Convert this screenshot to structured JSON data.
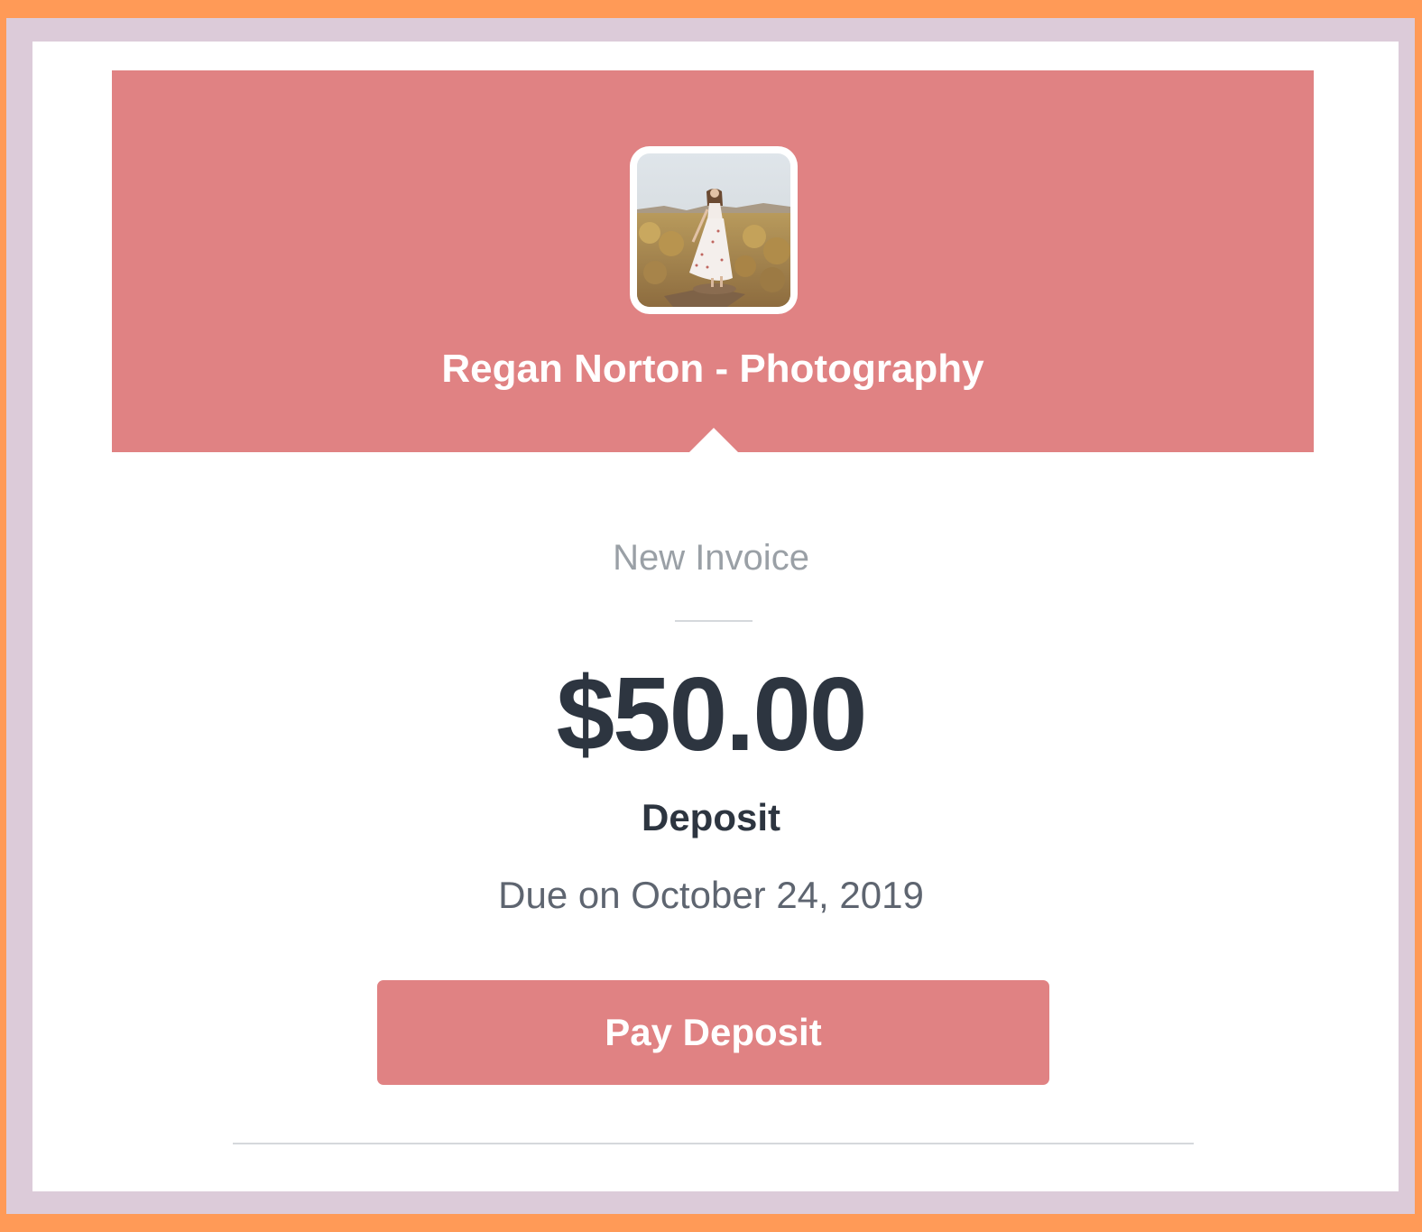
{
  "header": {
    "business_name": "Regan Norton - Photography",
    "brand_color": "#e08283"
  },
  "logo": {
    "icon": "business-logo-photo"
  },
  "invoice": {
    "heading": "New Invoice",
    "amount": "$50.00",
    "type": "Deposit",
    "due": "Due on October 24, 2019"
  },
  "actions": {
    "pay_label": "Pay Deposit"
  },
  "colors": {
    "frame_orange": "#ff9a57",
    "frame_lilac": "#dccbd9",
    "text_dark": "#2d3540",
    "text_muted": "#9aa0a6"
  }
}
